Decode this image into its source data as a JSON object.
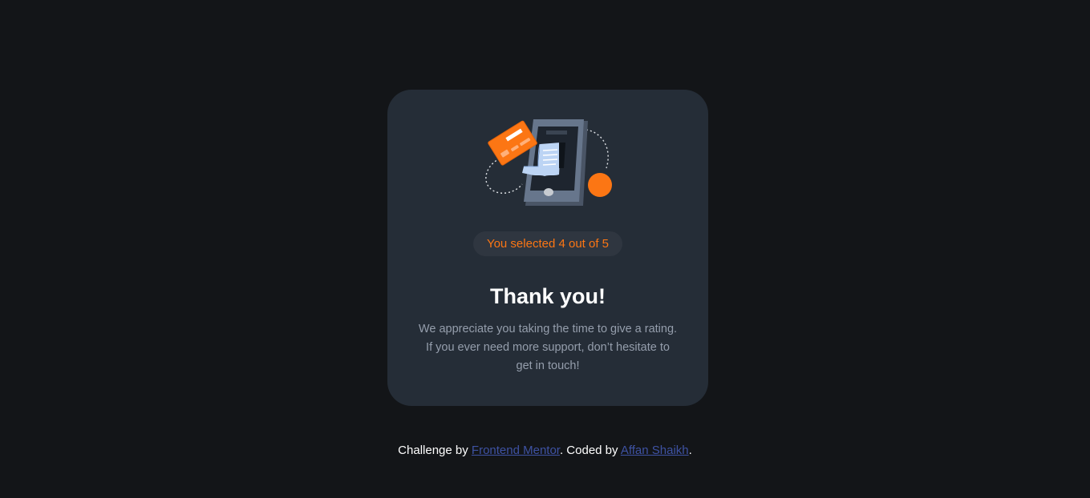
{
  "card": {
    "selection_text": "You selected 4 out of 5",
    "title": "Thank you!",
    "message_line1": "We appreciate you taking the time to give a rating.",
    "message_line2": "If you ever need more support, don’t hesitate to",
    "message_line3": "get in touch!",
    "illustration_icon": "phone-payment-illustration"
  },
  "attribution": {
    "prefix": "Challenge by ",
    "link1_label": "Frontend Mentor",
    "middle": ". Coded by ",
    "link2_label": "Affan Shaikh",
    "suffix": "."
  },
  "colors": {
    "background": "#131518",
    "card": "#252d37",
    "accent": "#fc7614",
    "muted_text": "#959eac",
    "link": "#3e52a3"
  }
}
